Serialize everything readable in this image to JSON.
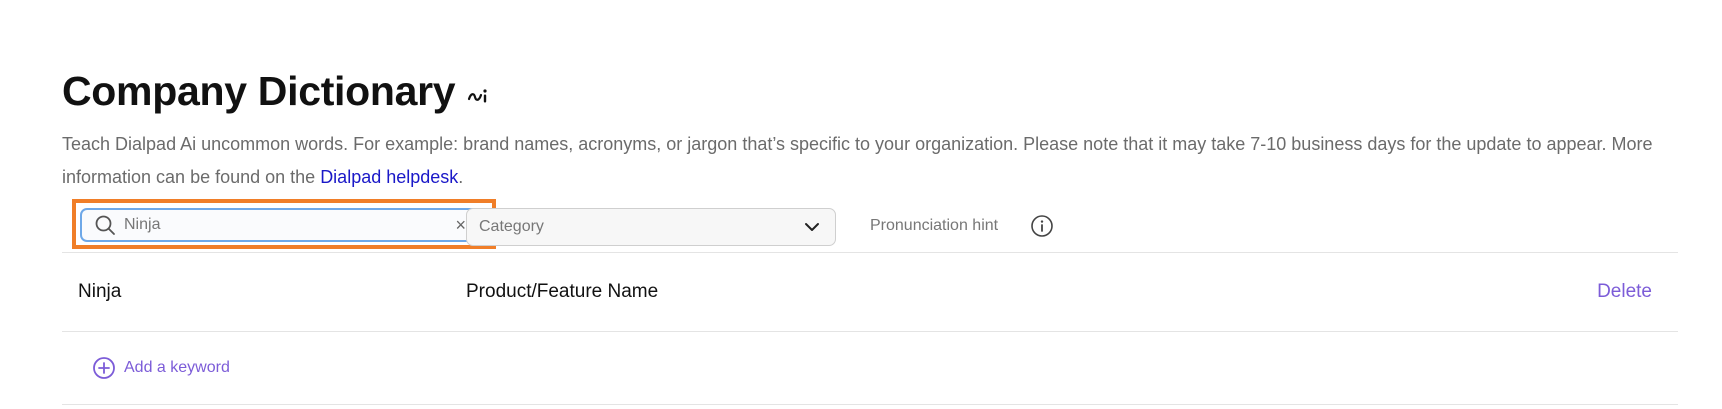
{
  "header": {
    "title": "Company Dictionary",
    "ai_badge": "ai-sparkle-icon"
  },
  "description": {
    "text": "Teach Dialpad Ai uncommon words. For example: brand names, acronyms, or jargon that’s specific to your organization. Please note that it may take 7-10 business days for the update to appear. More information can be found on the ",
    "link_label": "Dialpad helpdesk",
    "suffix": "."
  },
  "toolbar": {
    "search": {
      "value": "Ninja",
      "clear_symbol": "×",
      "icon": "search-icon"
    },
    "category": {
      "placeholder": "Category",
      "icon": "chevron-down-icon"
    },
    "pronunciation_hint": "Pronunciation hint",
    "info_icon": "info-icon"
  },
  "rows": [
    {
      "word": "Ninja",
      "category": "Product/Feature Name",
      "action": "Delete"
    }
  ],
  "add_keyword": {
    "label": "Add a keyword",
    "icon": "plus-circle-icon"
  },
  "colors": {
    "link": "#1a18c8",
    "accent_purple": "#7c5cd8",
    "highlight_orange": "#f07e28",
    "focus_blue": "#6ea8e8"
  }
}
